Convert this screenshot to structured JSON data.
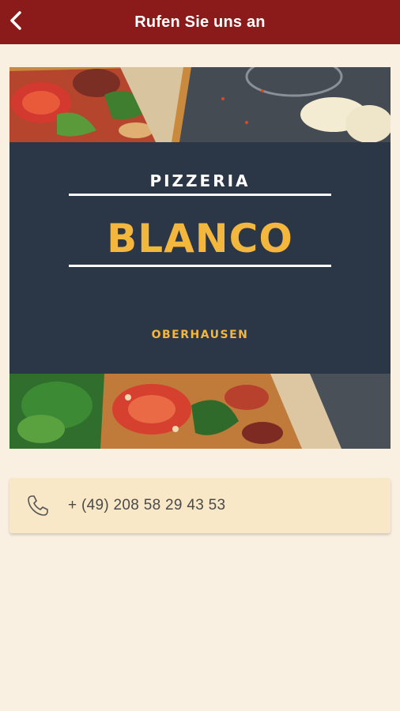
{
  "header": {
    "title": "Rufen Sie uns an",
    "back_icon": "chevron-left-icon"
  },
  "banner": {
    "subtitle": "PIZZERIA",
    "name": "BLANCO",
    "city": "OBERHAUSEN",
    "accent_color": "#f4b73d",
    "band_color": "#2b3646"
  },
  "contact": {
    "phone_icon": "phone-icon",
    "phone_number": "+ (49) 208 58 29 43 53"
  },
  "colors": {
    "header_bg": "#8b1a1a",
    "page_bg": "#faf0e2",
    "card_bg": "#f8e8c8"
  }
}
